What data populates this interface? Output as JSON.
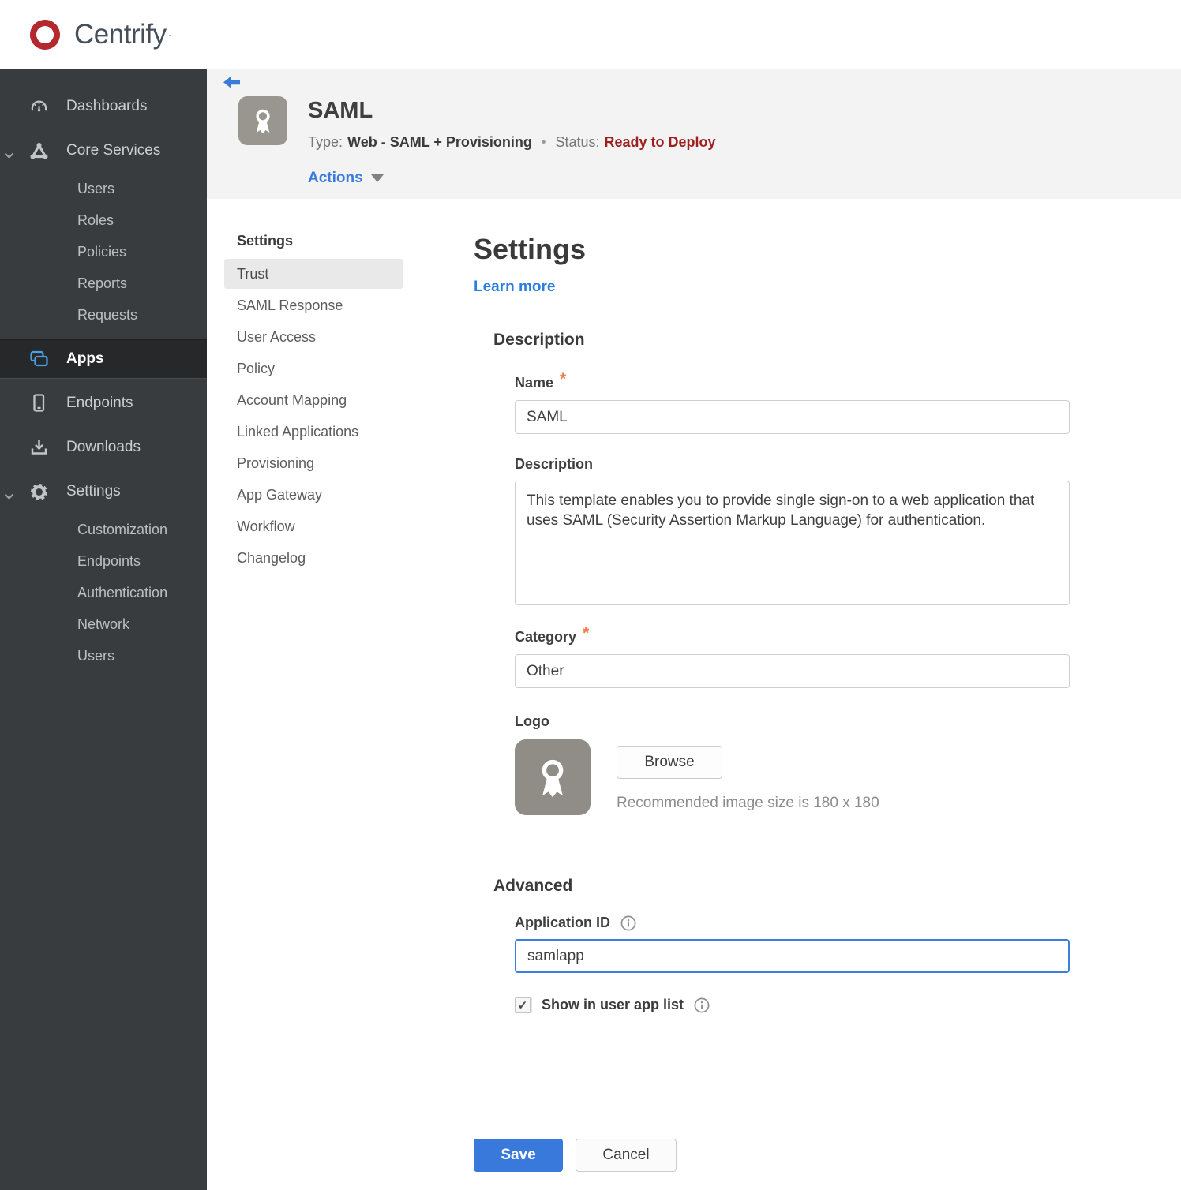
{
  "brand": {
    "name": "Centrify",
    "mark": "·"
  },
  "icons": {
    "logo": "centrify-swirl",
    "back": "arrow-left",
    "dashboards": "gauge",
    "core_services": "node-triangle",
    "apps": "overlapping-windows",
    "endpoints": "mobile-device",
    "downloads": "download-tray",
    "settings": "gear",
    "expand": "chevron-down",
    "app_avatar": "ribbon-award",
    "info": "info-circle",
    "actions_caret": "caret-down",
    "checkmark": "✓"
  },
  "colors": {
    "logo_red": "#b4292f",
    "accent_blue": "#3a7bd9",
    "link_blue": "#2a7de1",
    "save_blue": "#3a79dc",
    "apps_icon_blue": "#4aa0e6",
    "status_red": "#9e1f1f",
    "sidebar_bg": "#393c3e",
    "sidebar_active_bg": "#262829",
    "band_bg": "#f3f3f3",
    "focus_border_blue": "#3b7edd"
  },
  "sidebar": {
    "items": [
      {
        "label": "Dashboards"
      },
      {
        "label": "Core Services"
      },
      {
        "label": "Users"
      },
      {
        "label": "Roles"
      },
      {
        "label": "Policies"
      },
      {
        "label": "Reports"
      },
      {
        "label": "Requests"
      },
      {
        "label": "Apps"
      },
      {
        "label": "Endpoints"
      },
      {
        "label": "Downloads"
      },
      {
        "label": "Settings"
      },
      {
        "label": "Customization"
      },
      {
        "label": "Endpoints"
      },
      {
        "label": "Authentication"
      },
      {
        "label": "Network"
      },
      {
        "label": "Users"
      }
    ]
  },
  "header": {
    "title": "SAML",
    "type_label": "Type:",
    "type_value": "Web - SAML + Provisioning",
    "separator": "•",
    "status_label": "Status:",
    "status_value": "Ready to Deploy",
    "actions_label": "Actions"
  },
  "subnav": {
    "heading": "Settings",
    "items": [
      {
        "label": "Trust",
        "active": true
      },
      {
        "label": "SAML Response"
      },
      {
        "label": "User Access"
      },
      {
        "label": "Policy"
      },
      {
        "label": "Account Mapping"
      },
      {
        "label": "Linked Applications"
      },
      {
        "label": "Provisioning"
      },
      {
        "label": "App Gateway"
      },
      {
        "label": "Workflow"
      },
      {
        "label": "Changelog"
      }
    ]
  },
  "main": {
    "heading": "Settings",
    "learn_more_label": "Learn more",
    "required_marker": "*",
    "sections": {
      "description": {
        "heading": "Description",
        "fields": {
          "name": {
            "label": "Name",
            "value": "SAML",
            "required": true
          },
          "description": {
            "label": "Description",
            "value": "This template enables you to provide single sign-on to a web application that uses SAML (Security Assertion Markup Language) for authentication."
          },
          "category": {
            "label": "Category",
            "value": "Other",
            "required": true
          },
          "logo": {
            "label": "Logo",
            "browse_label": "Browse",
            "hint": "Recommended image size is 180 x 180"
          }
        }
      },
      "advanced": {
        "heading": "Advanced",
        "fields": {
          "application_id": {
            "label": "Application ID",
            "value": "samlapp"
          },
          "show_in_user_app_list": {
            "label": "Show in user app list",
            "checked": true
          }
        }
      }
    },
    "footer": {
      "save_label": "Save",
      "cancel_label": "Cancel"
    }
  }
}
